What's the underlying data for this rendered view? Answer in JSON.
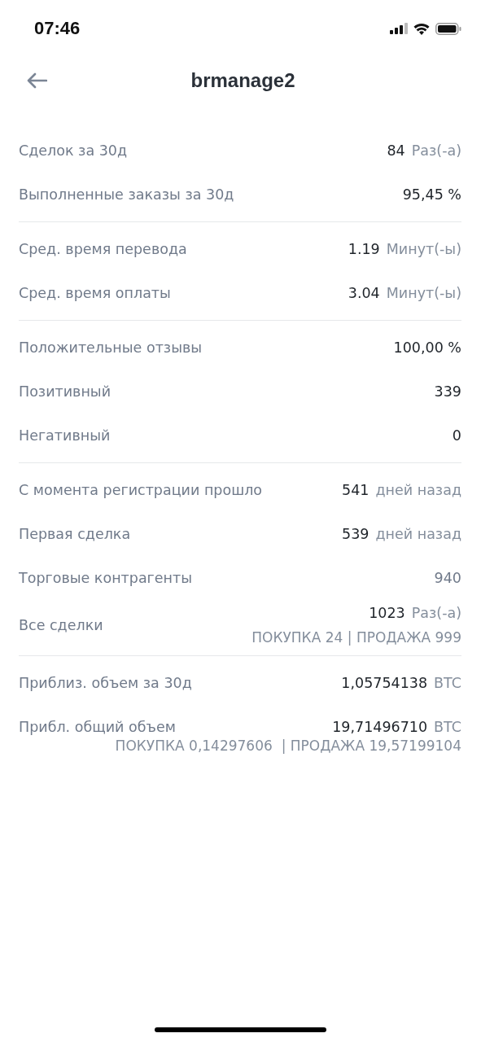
{
  "status_bar": {
    "time": "07:46"
  },
  "header": {
    "title": "brmanage2"
  },
  "sections": [
    {
      "rows": [
        {
          "label": "Сделок за 30д",
          "value": "84",
          "unit": "Раз(-а)",
          "muted": false
        },
        {
          "label": "Выполненные заказы за 30д",
          "value": "95,45 %",
          "muted": false
        }
      ]
    },
    {
      "rows": [
        {
          "label": "Сред. время перевода",
          "value": "1.19",
          "unit": "Минут(-ы)",
          "muted": false
        },
        {
          "label": "Сред. время оплаты",
          "value": "3.04",
          "unit": "Минут(-ы)",
          "muted": false
        }
      ]
    },
    {
      "rows": [
        {
          "label": "Положительные отзывы",
          "value": "100,00 %",
          "muted": false
        },
        {
          "label": "Позитивный",
          "value": "339",
          "muted": false
        },
        {
          "label": "Негативный",
          "value": "0",
          "muted": false
        }
      ]
    },
    {
      "rows": [
        {
          "label": "С момента регистрации прошло",
          "value": "541",
          "unit": "дней назад",
          "muted": false
        },
        {
          "label": "Первая сделка",
          "value": "539",
          "unit": "дней назад",
          "muted": false
        },
        {
          "label": "Торговые контрагенты",
          "value": "940",
          "muted": true
        },
        {
          "label": "Все сделки",
          "value": "1023",
          "unit": "Раз(-а)",
          "muted": false,
          "kind": "centered",
          "detail": "ПОКУПКА 24 | ПРОДАЖА 999"
        }
      ]
    },
    {
      "rows": [
        {
          "label": "Приблиз. объем за 30д",
          "value": "1,05754138",
          "unit": "BTC",
          "muted": false
        },
        {
          "label": "Прибл. общий объем",
          "value": "19,71496710",
          "unit": "BTC",
          "muted": false,
          "kind": "wide",
          "detail": "ПОКУПКА 0,14297606  | ПРОДАЖА 19,57199104"
        }
      ]
    }
  ]
}
